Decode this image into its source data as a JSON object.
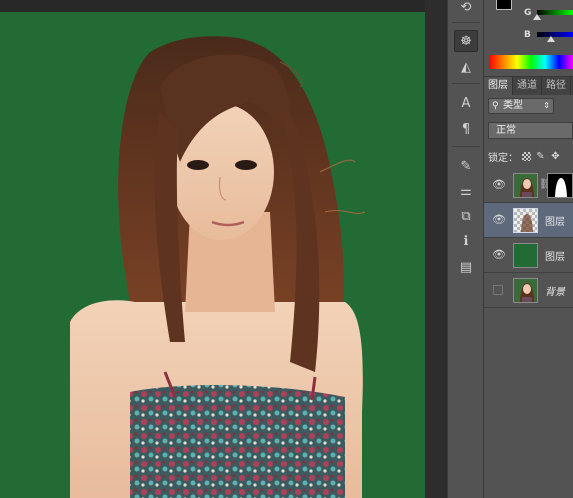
{
  "color_panel": {
    "label_g": "G",
    "label_b": "B",
    "foreground": "#000000"
  },
  "icon_strip": {
    "buttons": [
      {
        "icon": "link-icon",
        "glyph": "⟲"
      },
      {
        "icon": "navigator-icon",
        "glyph": "☸"
      },
      {
        "icon": "histogram-icon",
        "glyph": "◭"
      },
      {
        "icon": "character-icon",
        "glyph": "A"
      },
      {
        "icon": "paragraph-icon",
        "glyph": "¶"
      },
      {
        "icon": "brush-presets-icon",
        "glyph": "✎"
      },
      {
        "icon": "adjustments-icon",
        "glyph": "⚌"
      },
      {
        "icon": "clone-source-icon",
        "glyph": "⧉"
      },
      {
        "icon": "info-icon",
        "glyph": "ℹ"
      },
      {
        "icon": "notes-icon",
        "glyph": "▤"
      }
    ]
  },
  "layers_panel": {
    "tabs": [
      "图层",
      "通道",
      "路径"
    ],
    "filter_label": "类型",
    "blend_mode": "正常",
    "lock_label": "锁定：",
    "layers": [
      {
        "name": "",
        "visible": true,
        "selected": false,
        "has_mask": true,
        "thumb": "photo"
      },
      {
        "name": "图层",
        "visible": true,
        "selected": true,
        "has_mask": false,
        "thumb": "transparent"
      },
      {
        "name": "图层",
        "visible": true,
        "selected": false,
        "has_mask": false,
        "thumb": "green"
      },
      {
        "name": "背景",
        "visible": false,
        "selected": false,
        "has_mask": false,
        "thumb": "photo"
      }
    ]
  },
  "colors": {
    "canvas_bg": "#236b35",
    "panel_bg": "#535353",
    "selected_row": "#5e6a7c"
  }
}
